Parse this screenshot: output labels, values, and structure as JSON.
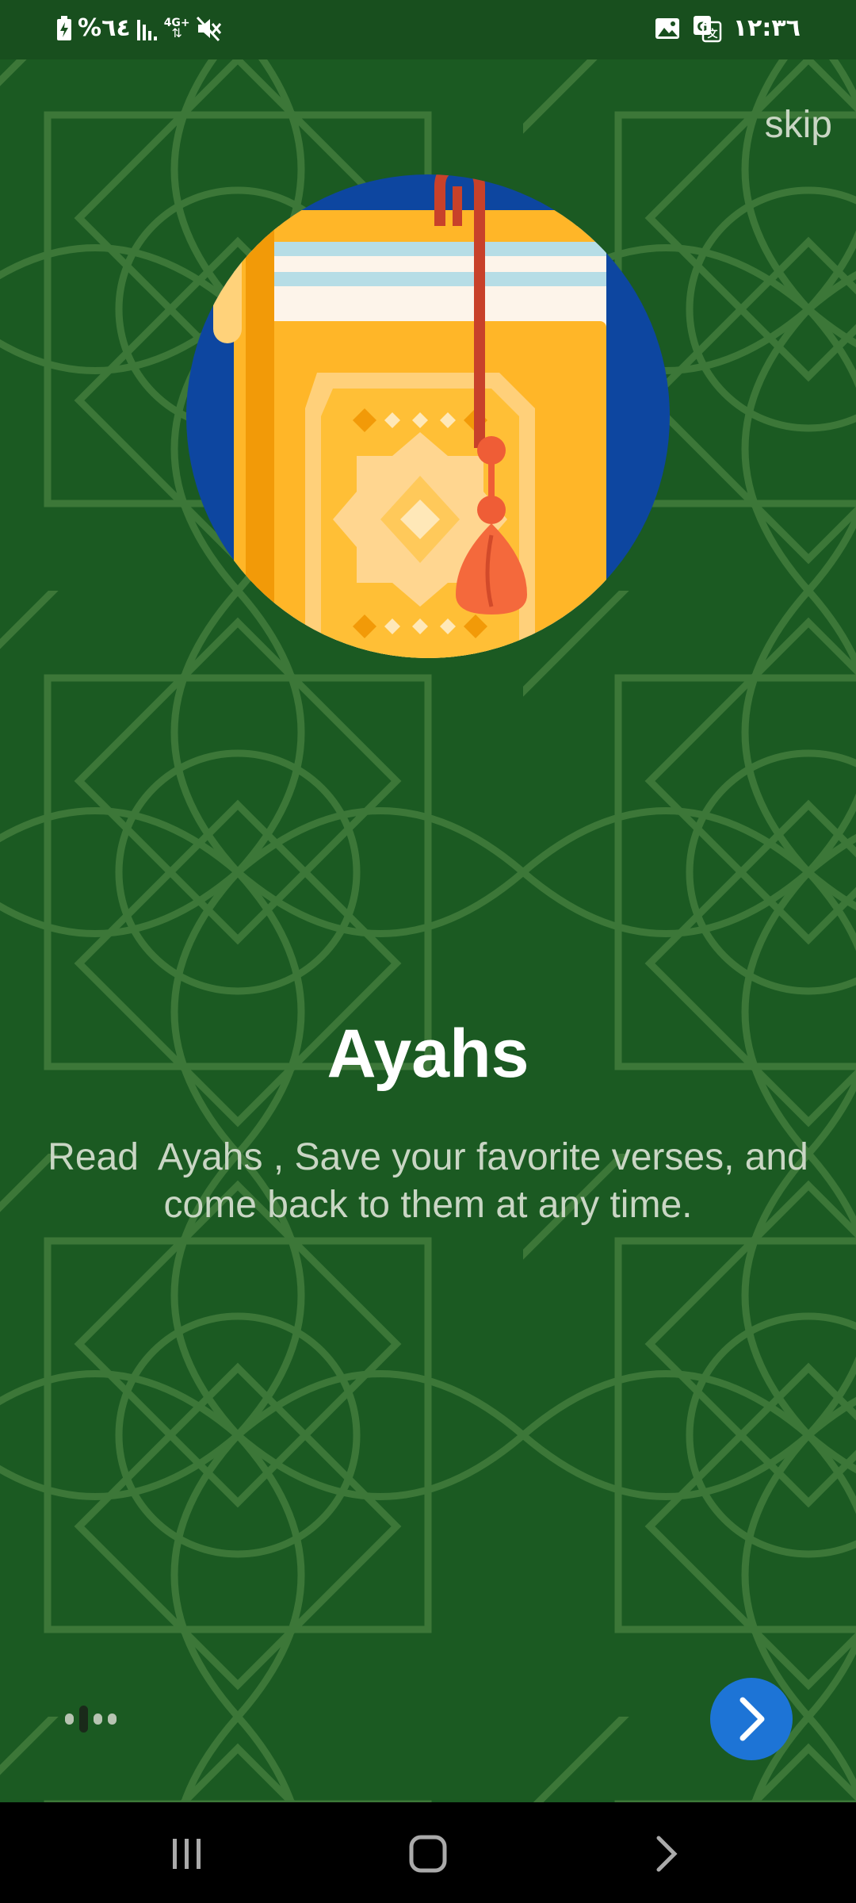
{
  "status_bar": {
    "battery_text": "%٦٤",
    "network_label": "4G+",
    "time": "١٢:٣٦"
  },
  "onboarding": {
    "skip_label": "skip",
    "title": "Ayahs",
    "description": "Read  Ayahs , Save your favorite verses, and\ncome back to them at any time.",
    "page_count": 4,
    "current_page": 2,
    "next_icon": "chevron-right-icon"
  },
  "colors": {
    "background": "#1b5a22",
    "status_bar": "#184f1e",
    "accent_button": "#1d74d6",
    "text_primary": "#ffffff",
    "text_secondary": "#c9d6c4"
  },
  "nav_bar": {
    "icons": [
      "recent-apps-icon",
      "home-icon",
      "back-icon"
    ]
  }
}
